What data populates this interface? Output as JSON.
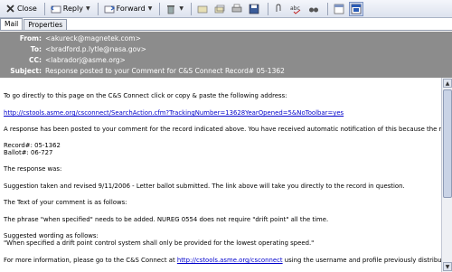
{
  "toolbar": {
    "close_label": "Close",
    "reply_label": "Reply",
    "forward_label": "Forward"
  },
  "tabs": [
    "Mail",
    "Properties"
  ],
  "header": {
    "from_label": "From:",
    "from_value": "<akureck@magnetek.com>",
    "to_label": "To:",
    "to_value": "<bradford.p.lytle@nasa.gov>",
    "cc_label": "CC:",
    "cc_value": "<labradorj@asme.org>",
    "subject_label": "Subject:",
    "subject_value": "Response posted to your Comment for C&S Connect Record# 05-1362"
  },
  "body": {
    "line1": "To go directly to this page on the C&S Connect click or copy & paste the following address:",
    "link1": "http://cstools.asme.org/csconnect/SearchAction.cfm?TrackingNumber=13628YearOpened=5&NoToolbar=yes",
    "line2": "A response has been posted to your comment for the record indicated above.  You have received automatic notification of this because the record",
    "record": "Record#: 05-1362",
    "ballot": "Ballot#: 06-727",
    "response_heading": "The response was:",
    "response_text": "Suggestion taken and revised 9/11/2006 - Letter ballot submitted.  The link above will take you directly to the record in question.",
    "comment_heading": "The Text of your comment is as follows:",
    "comment_text": "The phrase \"when specified\" needs to be added.  NUREG 0554 does not require \"drift point\" all the time.",
    "suggested_heading": "Suggested wording as follows:",
    "suggested_text": "\"When specified a drift point control system shall only be provided for the lowest operating speed.\"",
    "more_info_prefix": "For more information, please go to the C&S Connect at ",
    "more_info_link": "http://cstools.asme.org/csconnect",
    "more_info_suffix": " using the username and profile previously distributed to"
  }
}
